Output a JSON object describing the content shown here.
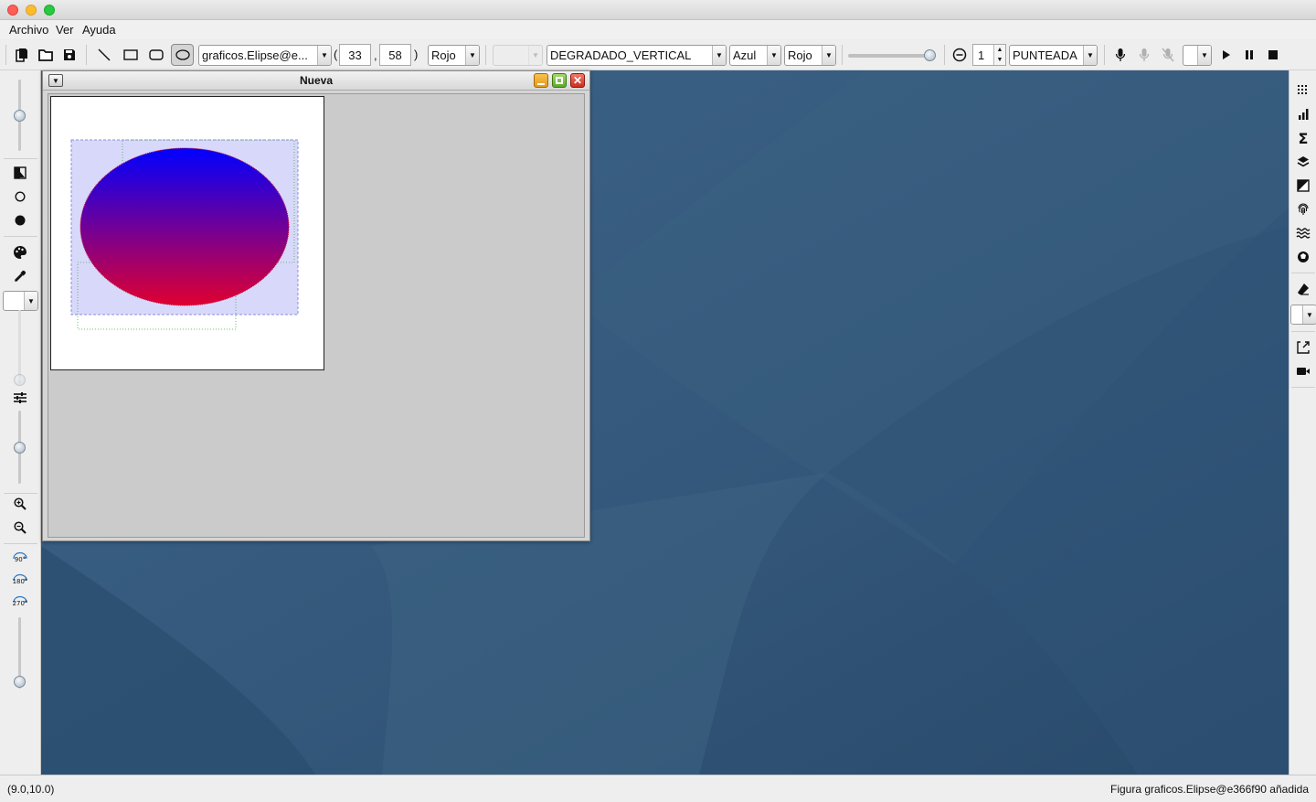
{
  "window": {
    "controls": {
      "close": "#fc5f57",
      "minimize": "#fdbc2e",
      "maximize": "#28c840"
    }
  },
  "menu": {
    "items": [
      "Archivo",
      "Ver",
      "Ayuda"
    ]
  },
  "toolbar": {
    "tools": [
      "new-file-icon",
      "open-folder-icon",
      "save-icon",
      "line-tool-icon",
      "rectangle-tool-icon",
      "round-rectangle-tool-icon",
      "ellipse-tool-icon"
    ],
    "shape_select": "graficos.Elipse@e...",
    "coord_open": "(",
    "coord_x": "33",
    "coord_comma": ",",
    "coord_y": "58",
    "coord_close": ")",
    "stroke_color": "Rojo",
    "fill_type": "DEGRADADO_VERTICAL",
    "gradient_color1": "Azul",
    "gradient_color2": "Rojo",
    "transparency_level": 1.0,
    "stroke_width": "1",
    "stroke_style": "PUNTEADA",
    "media": [
      "microphone-icon",
      "microphone-icon",
      "microphone-off-icon",
      "play-icon",
      "pause-icon",
      "stop-icon"
    ]
  },
  "left_tools": [
    "contrast-icon",
    "circle-outline-icon",
    "circle-filled-icon",
    "palette-icon",
    "eyedropper-icon",
    "tune-icon",
    "zoom-in-icon",
    "zoom-out-icon"
  ],
  "rotate_labels": [
    "90°",
    "180°",
    "270°"
  ],
  "right_tools": [
    "grid-icon",
    "bar-chart-icon",
    "sigma-icon",
    "layers-icon",
    "contrast-icon",
    "fingerprint-icon",
    "waves-icon",
    "aperture-icon",
    "eraser-icon",
    "export-icon",
    "video-camera-icon"
  ],
  "frame": {
    "title": "Nueva"
  },
  "figure": {
    "type": "Elipse",
    "gradient": "vertical",
    "top_color": "#0000ff",
    "bottom_color": "#e00030",
    "selection_color": "#d8d8fb"
  },
  "status": {
    "coords": "(9.0,10.0)",
    "message": "Figura graficos.Elipse@e366f90 añadida"
  }
}
